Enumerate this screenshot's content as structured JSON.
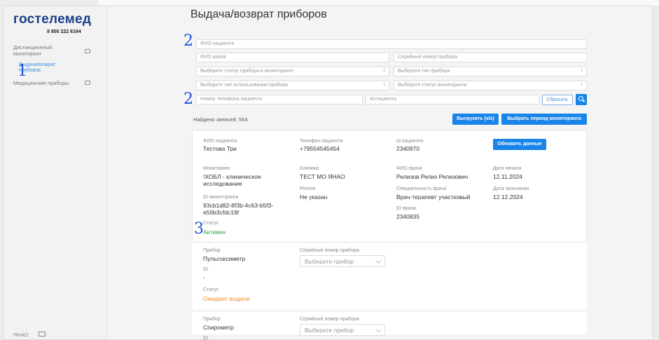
{
  "sidebar": {
    "logo": "гостелемед",
    "phone": "8 800 222 6164",
    "group1_line1": "Дистанционный",
    "group1_line2": "мониторинг",
    "active_line1": "Выдача/возврат",
    "active_line2": "приборов",
    "group2": "Медицинские приборы",
    "footer": "ЯНАО"
  },
  "markers": {
    "m1": "1",
    "m2a": "2",
    "m2b": "2",
    "m3": "3"
  },
  "page": {
    "title": "Выдача/возврат приборов"
  },
  "filters": {
    "patient_name": "ФИО пациента",
    "doctor_name": "ФИО врача",
    "serial": "Серийный номер прибора",
    "device_status": "Выберите статус прибора в мониторинге",
    "device_type": "Выберите тип прибора",
    "usage_type": "Выберите тип использования прибора",
    "monitoring_status": "Выберите статус мониторинга",
    "patient_phone": "Номер телефона пациента",
    "patient_id": "Id пациента",
    "reset": "Сбросить"
  },
  "toolbar": {
    "found": "Найдено записей: 554",
    "export": "Выгрузить (xls)",
    "period": "Выбрать период мониторинга"
  },
  "record": {
    "patient_label": "ФИО пациента",
    "patient_value": "Тестова Три",
    "phone_label": "Телефон пациента",
    "phone_value": "+79554545454",
    "id_label": "Id пациента",
    "id_value": "2340970",
    "refresh": "Обновить данные",
    "monitoring_label": "Мониторинг",
    "monitoring_value1": "!ХОБЛ - клиническое",
    "monitoring_value2": "исследование",
    "clinic_label": "Клиника",
    "clinic_value": "ТЕСТ МО ЯНАО",
    "doctor_label": "ФИО врача",
    "doctor_value": "Релизов Релиз Релизович",
    "start_label": "Дата начала",
    "start_value": "12.11.2024",
    "region_label": "Регион",
    "region_value": "Не указан",
    "spec_label": "Специальность врача",
    "spec_value": "Врач-терапевт участковый",
    "end_label": "Дата окончания",
    "end_value": "12.12.2024",
    "mon_id_label": "ID мониторинга",
    "mon_id_value1": "93cb1d82-8f3b-4c63-b5f3-",
    "mon_id_value2": "e56b3cfdc19f",
    "doc_id_label": "ID врача",
    "doc_id_value": "2340835",
    "status_label": "Статус",
    "status_value": "Активен"
  },
  "devices": [
    {
      "device_label": "Прибор",
      "device_value": "Пульсоксиметр",
      "serial_label": "Серийный номер прибора",
      "serial_placeholder": "Выберите прибор",
      "id_label": "ID",
      "id_value": "-",
      "status_label": "Статус",
      "status_value": "Ожидает выдачи"
    },
    {
      "device_label": "Прибор",
      "device_value": "Спирометр",
      "serial_label": "Серийный номер прибора",
      "serial_placeholder": "Выберите прибор",
      "id_label": "ID"
    }
  ]
}
